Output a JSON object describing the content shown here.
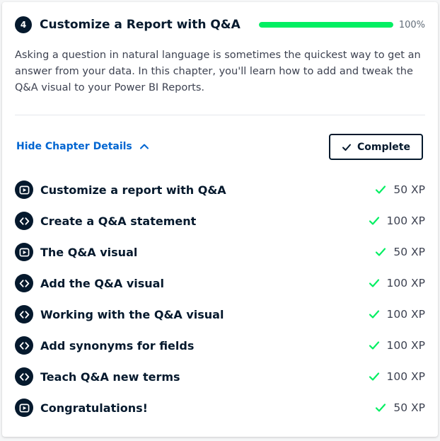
{
  "chapter": {
    "number": "4",
    "title": "Customize a Report with Q&A",
    "progress_percent": 100,
    "progress_label": "100%",
    "description": "Asking a question in natural language is sometimes the quickest way to get an answer from your data. In this chapter, you'll learn how to add and tweak the Q&A visual to your Power BI Reports."
  },
  "actions": {
    "toggle_label": "Hide Chapter Details",
    "complete_label": "Complete"
  },
  "colors": {
    "progress": "#03ef62",
    "check": "#03ef62",
    "link": "#0065d1",
    "navy": "#05192d"
  },
  "exercises": [
    {
      "icon": "video-icon",
      "title": "Customize a report with Q&A",
      "xp": "50 XP"
    },
    {
      "icon": "code-icon",
      "title": "Create a Q&A statement",
      "xp": "100 XP"
    },
    {
      "icon": "video-icon",
      "title": "The Q&A visual",
      "xp": "50 XP"
    },
    {
      "icon": "code-icon",
      "title": "Add the Q&A visual",
      "xp": "100 XP"
    },
    {
      "icon": "code-icon",
      "title": "Working with the Q&A visual",
      "xp": "100 XP"
    },
    {
      "icon": "code-icon",
      "title": "Add synonyms for fields",
      "xp": "100 XP"
    },
    {
      "icon": "code-icon",
      "title": "Teach Q&A new terms",
      "xp": "100 XP"
    },
    {
      "icon": "video-icon",
      "title": "Congratulations!",
      "xp": "50 XP"
    }
  ]
}
